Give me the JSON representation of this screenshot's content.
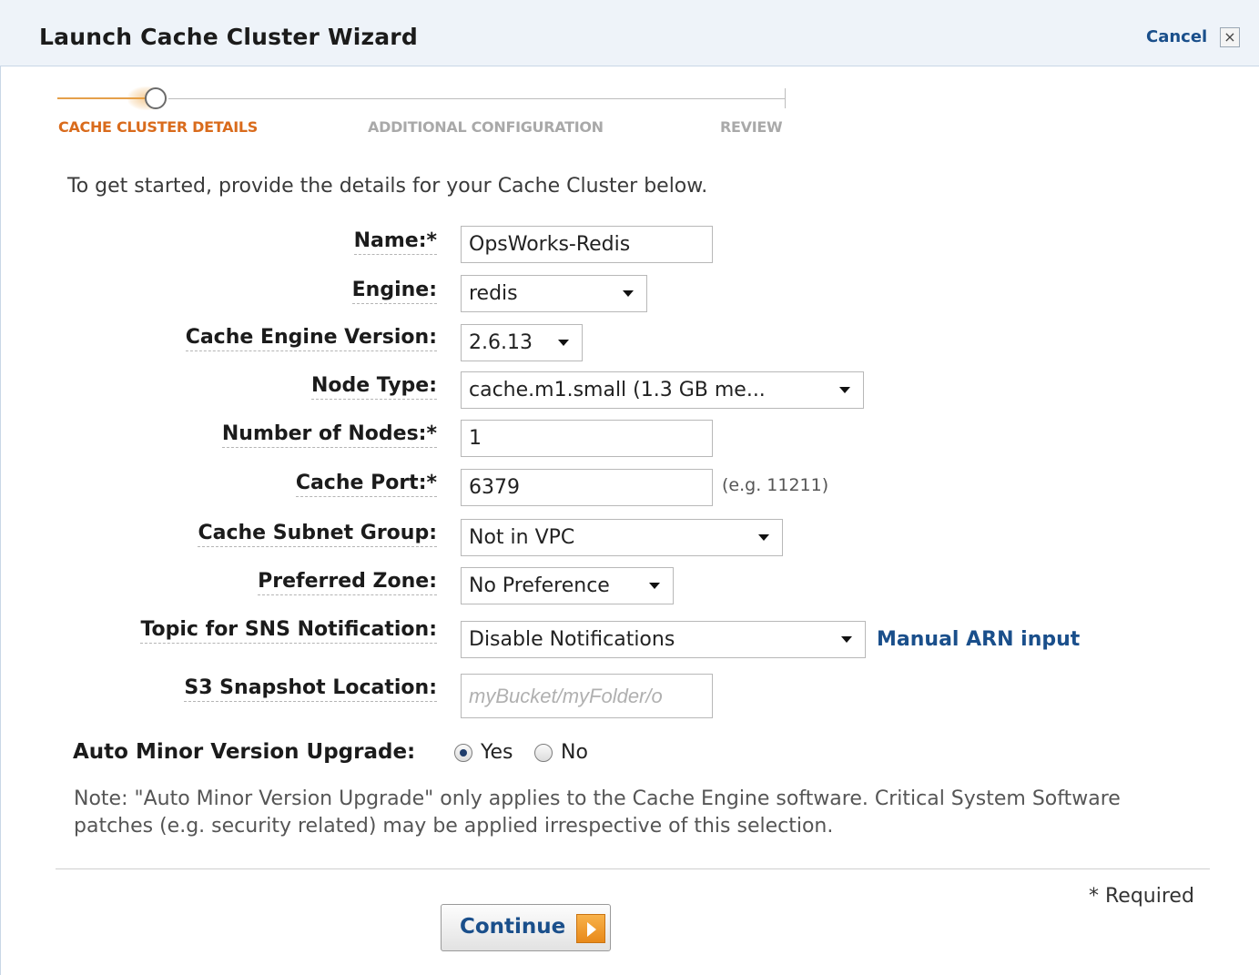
{
  "window": {
    "title": "Launch Cache Cluster Wizard",
    "cancel_label": "Cancel",
    "close_glyph": "×"
  },
  "progress": {
    "steps": [
      "CACHE CLUSTER DETAILS",
      "ADDITIONAL CONFIGURATION",
      "REVIEW"
    ],
    "current_step": 1
  },
  "intro": "To get started, provide the details for your Cache Cluster below.",
  "form": {
    "name": {
      "label": "Name:*",
      "value": "OpsWorks-Redis"
    },
    "engine": {
      "label": "Engine:",
      "value": "redis"
    },
    "engine_version": {
      "label": "Cache Engine Version:",
      "value": "2.6.13"
    },
    "node_type": {
      "label": "Node Type:",
      "value": "cache.m1.small (1.3 GB me..."
    },
    "num_nodes": {
      "label": "Number of Nodes:*",
      "value": "1"
    },
    "cache_port": {
      "label": "Cache Port:*",
      "value": "6379",
      "hint": "(e.g. 11211)"
    },
    "subnet_group": {
      "label": "Cache Subnet Group:",
      "value": "Not in VPC"
    },
    "preferred_zone": {
      "label": "Preferred Zone:",
      "value": "No Preference"
    },
    "sns_topic": {
      "label": "Topic for SNS Notification:",
      "value": "Disable Notifications",
      "link": "Manual ARN input"
    },
    "s3_snapshot": {
      "label": "S3 Snapshot Location:",
      "placeholder": "myBucket/myFolder/o"
    },
    "auto_minor": {
      "label": "Auto Minor Version Upgrade:",
      "yes": "Yes",
      "no": "No",
      "selected": "Yes"
    }
  },
  "note": "Note: \"Auto Minor Version Upgrade\" only applies to the Cache Engine software. Critical System Software patches (e.g. security related) may be applied irrespective of this selection.",
  "required_note": "* Required",
  "continue_label": "Continue",
  "colors": {
    "accent_orange": "#d96b1c",
    "link_blue": "#1a4f8b",
    "titlebar_bg": "#eef3f9"
  }
}
